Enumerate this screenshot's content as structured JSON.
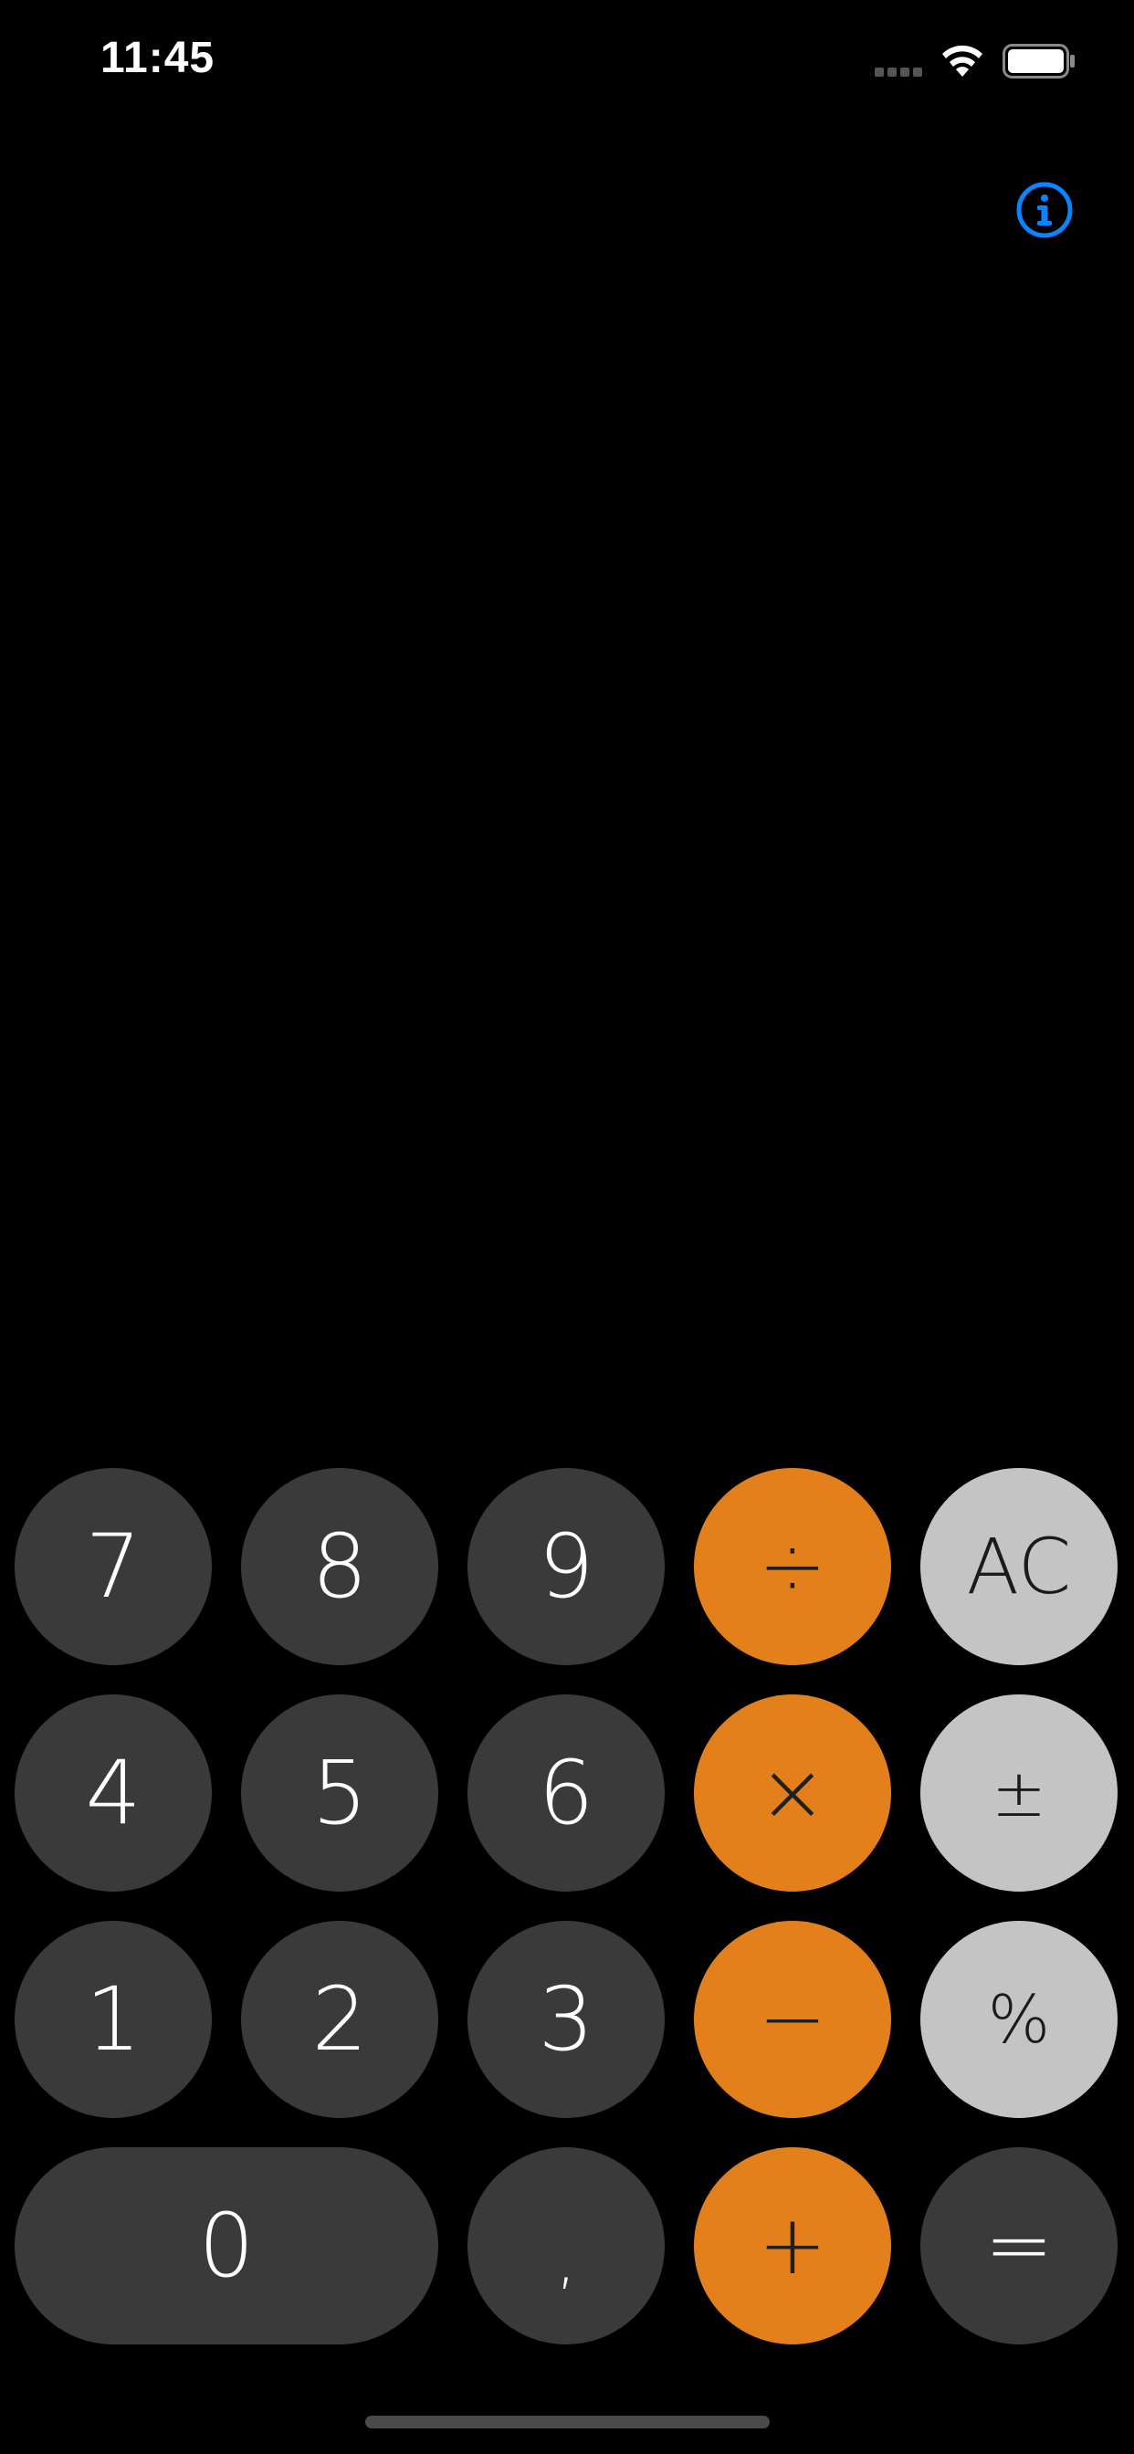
{
  "status_bar": {
    "time": "11:45",
    "icons": [
      "signal-icon",
      "wifi-icon",
      "battery-icon"
    ]
  },
  "header": {
    "info_icon": "info-icon",
    "accent_color": "#0a84ff"
  },
  "display": {
    "value": ""
  },
  "colors": {
    "background": "#000000",
    "digit_key": "#3a3a3a",
    "function_key": "#c4c4c4",
    "operator_key": "#e4801c"
  },
  "keypad": {
    "row1": [
      "7",
      "8",
      "9",
      "÷",
      "AC"
    ],
    "row2": [
      "4",
      "5",
      "6",
      "×",
      "±"
    ],
    "row3": [
      "1",
      "2",
      "3",
      "−",
      "%"
    ],
    "row4": [
      "0",
      ",",
      "+",
      "="
    ]
  }
}
